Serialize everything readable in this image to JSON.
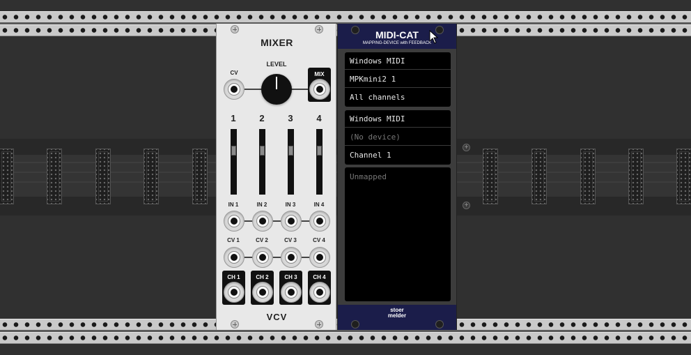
{
  "mixer": {
    "title": "MIXER",
    "level_label": "LEVEL",
    "cv_label": "CV",
    "mix_label": "MIX",
    "channel_numbers": [
      "1",
      "2",
      "3",
      "4"
    ],
    "in_labels": [
      "IN 1",
      "IN 2",
      "IN 3",
      "IN 4"
    ],
    "cv_labels": [
      "CV 1",
      "CV 2",
      "CV 3",
      "CV 4"
    ],
    "ch_labels": [
      "CH 1",
      "CH 2",
      "CH 3",
      "CH 4"
    ],
    "logo": "VCV"
  },
  "midicat": {
    "title": "MIDI-CAT",
    "subtitle": "MAPPING-DEVICE with FEEDBACK",
    "input": {
      "driver": "Windows MIDI",
      "device": "MPKmini2 1",
      "channel": "All channels"
    },
    "output": {
      "driver": "Windows MIDI",
      "device": "(No device)",
      "channel": "Channel 1"
    },
    "mapping_status": "Unmapped",
    "brand_line1": "stoer",
    "brand_line2": "melder"
  },
  "colors": {
    "mixer_panel": "#e8e8e8",
    "midicat_header": "#1b1d4a",
    "display_bg": "#000000"
  }
}
